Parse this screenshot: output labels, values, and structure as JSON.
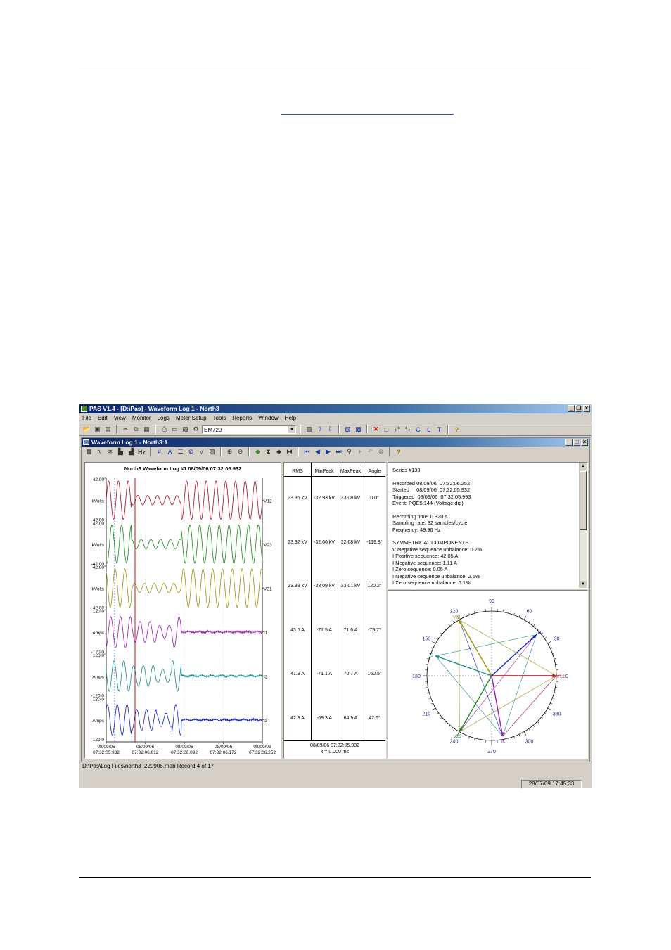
{
  "app": {
    "title": "PAS V1.4 - [D:\\Pas] - Waveform Log 1 - North3",
    "menu": [
      "File",
      "Edit",
      "View",
      "Monitor",
      "Logs",
      "Meter Setup",
      "Tools",
      "Reports",
      "Window",
      "Help"
    ],
    "device": "EM720"
  },
  "child": {
    "title": "Waveform Log 1 - North3:1"
  },
  "waveform": {
    "title": "North3  Waveform Log #1   08/09/06  07:32:05.932",
    "channels": [
      {
        "name": "V12",
        "unit": "kVolts",
        "max": "42.00",
        "min": "-42.00",
        "color": "#a0102a"
      },
      {
        "name": "V23",
        "unit": "kVolts",
        "max": "42.00",
        "min": "-42.00",
        "color": "#1a8a1a"
      },
      {
        "name": "V31",
        "unit": "kVolts",
        "max": "42.00",
        "min": "-42.00",
        "color": "#a09010"
      },
      {
        "name": "I1",
        "unit": "Amps",
        "max": "120.0",
        "min": "-120.0",
        "color": "#9a1ab0"
      },
      {
        "name": "I2",
        "unit": "Amps",
        "max": "120.0",
        "min": "-120.0",
        "color": "#1a8a90"
      },
      {
        "name": "I3",
        "unit": "Amps",
        "max": "120.0",
        "min": "-120.0",
        "color": "#1020c0"
      }
    ],
    "time_labels": [
      {
        "date": "08/09/06",
        "time": "07:32:05.932"
      },
      {
        "date": "08/09/06",
        "time": "07:32:06.012"
      },
      {
        "date": "08/09/06",
        "time": "07:32:06.092"
      },
      {
        "date": "08/09/06",
        "time": "07:32:06.172"
      },
      {
        "date": "08/09/06",
        "time": "07:32:06.252"
      }
    ]
  },
  "measurements": {
    "headers": [
      "RMS",
      "MinPeak",
      "MaxPeak",
      "Angle"
    ],
    "rows": [
      [
        "23.35 kV",
        "-32.93 kV",
        "33.08 kV",
        "0.0°"
      ],
      [
        "23.32 kV",
        "-32.66 kV",
        "32.68 kV",
        "-119.8°"
      ],
      [
        "23.39 kV",
        "-33.09 kV",
        "33.01 kV",
        "120.2°"
      ],
      [
        "43.6 A",
        "-71.5 A",
        "71.6 A",
        "-79.7°"
      ],
      [
        "41.9 A",
        "-71.1 A",
        "70.7 A",
        "160.5°"
      ],
      [
        "42.8 A",
        "-69.3 A",
        "64.9 A",
        "42.6°"
      ]
    ],
    "footer_time": "08/09/06  07:32:05.932",
    "footer_x": "x = 0.000 ms"
  },
  "info": {
    "lines": [
      "Series #133",
      "",
      "Recorded 08/09/06  07:32:06.252",
      "Started     08/09/06  07:32:05.932",
      "Triggered  08/09/06  07:32:05.993",
      "Event: PQE5:144 (Voltage dip)",
      "",
      "Recording time: 0.320 s",
      "Sampling rate: 32 samples/cycle",
      "Frequency: 49.96 Hz",
      "",
      "SYMMETRICAL COMPONENTS",
      "V Negative sequence unbalance: 0.2%",
      "I Positive sequence: 42.05 A",
      "I Negative sequence: 1.11 A",
      "I Zero sequence: 0.05 A",
      "I Negative sequence unbalance: 2.6%",
      "I Zero sequence unbalance: 0.1%"
    ]
  },
  "phasor": {
    "angle_labels": [
      "0",
      "30",
      "60",
      "90",
      "120",
      "150",
      "180",
      "210",
      "240",
      "270",
      "300",
      "330"
    ],
    "vectors": [
      {
        "name": "V12",
        "angle": 0,
        "mag": 1.0,
        "color": "#a0102a"
      },
      {
        "name": "V23",
        "angle": -119.8,
        "mag": 1.0,
        "color": "#1a8a1a"
      },
      {
        "name": "V31",
        "angle": 120.2,
        "mag": 1.0,
        "color": "#a09010"
      },
      {
        "name": "I1",
        "angle": -79.7,
        "mag": 0.95,
        "color": "#9a1ab0"
      },
      {
        "name": "I2",
        "angle": 160.5,
        "mag": 0.92,
        "color": "#1a8a90"
      },
      {
        "name": "I3",
        "angle": 42.6,
        "mag": 0.94,
        "color": "#1020c0"
      }
    ]
  },
  "status": {
    "path": "D:\\Pas\\Log Files\\north3_220906.mdb   Record 4 of 17",
    "clock": "28/07/09 17:45:33"
  }
}
